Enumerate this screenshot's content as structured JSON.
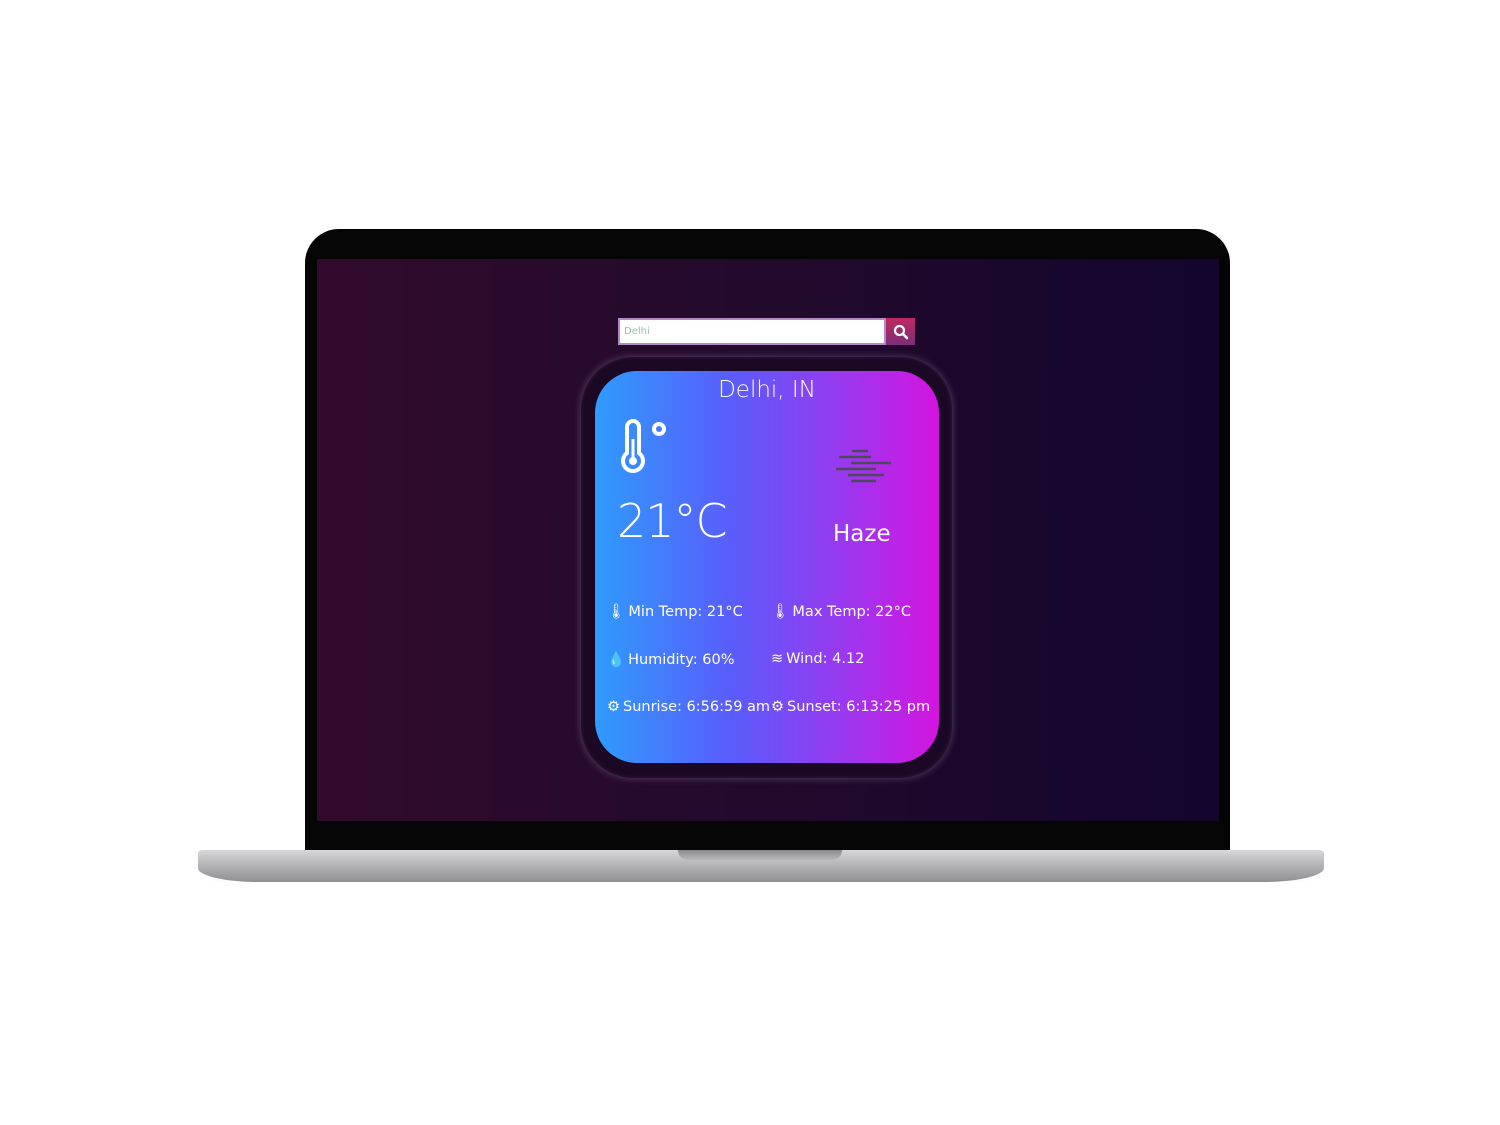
{
  "search": {
    "value": "Delhi",
    "button": "search"
  },
  "weather": {
    "city": "Delhi, IN",
    "temperature": "21°C",
    "condition": "Haze",
    "min_temp": "Min Temp: 21°C",
    "max_temp": "Max Temp: 22°C",
    "humidity": "Humidity: 60%",
    "wind": "Wind: 4.12",
    "sunrise": "Sunrise: 6:56:59 am",
    "sunset": "Sunset: 6:13:25 pm"
  },
  "colors": {
    "gradient_start": "#2f9bfd",
    "gradient_end": "#d414df"
  }
}
